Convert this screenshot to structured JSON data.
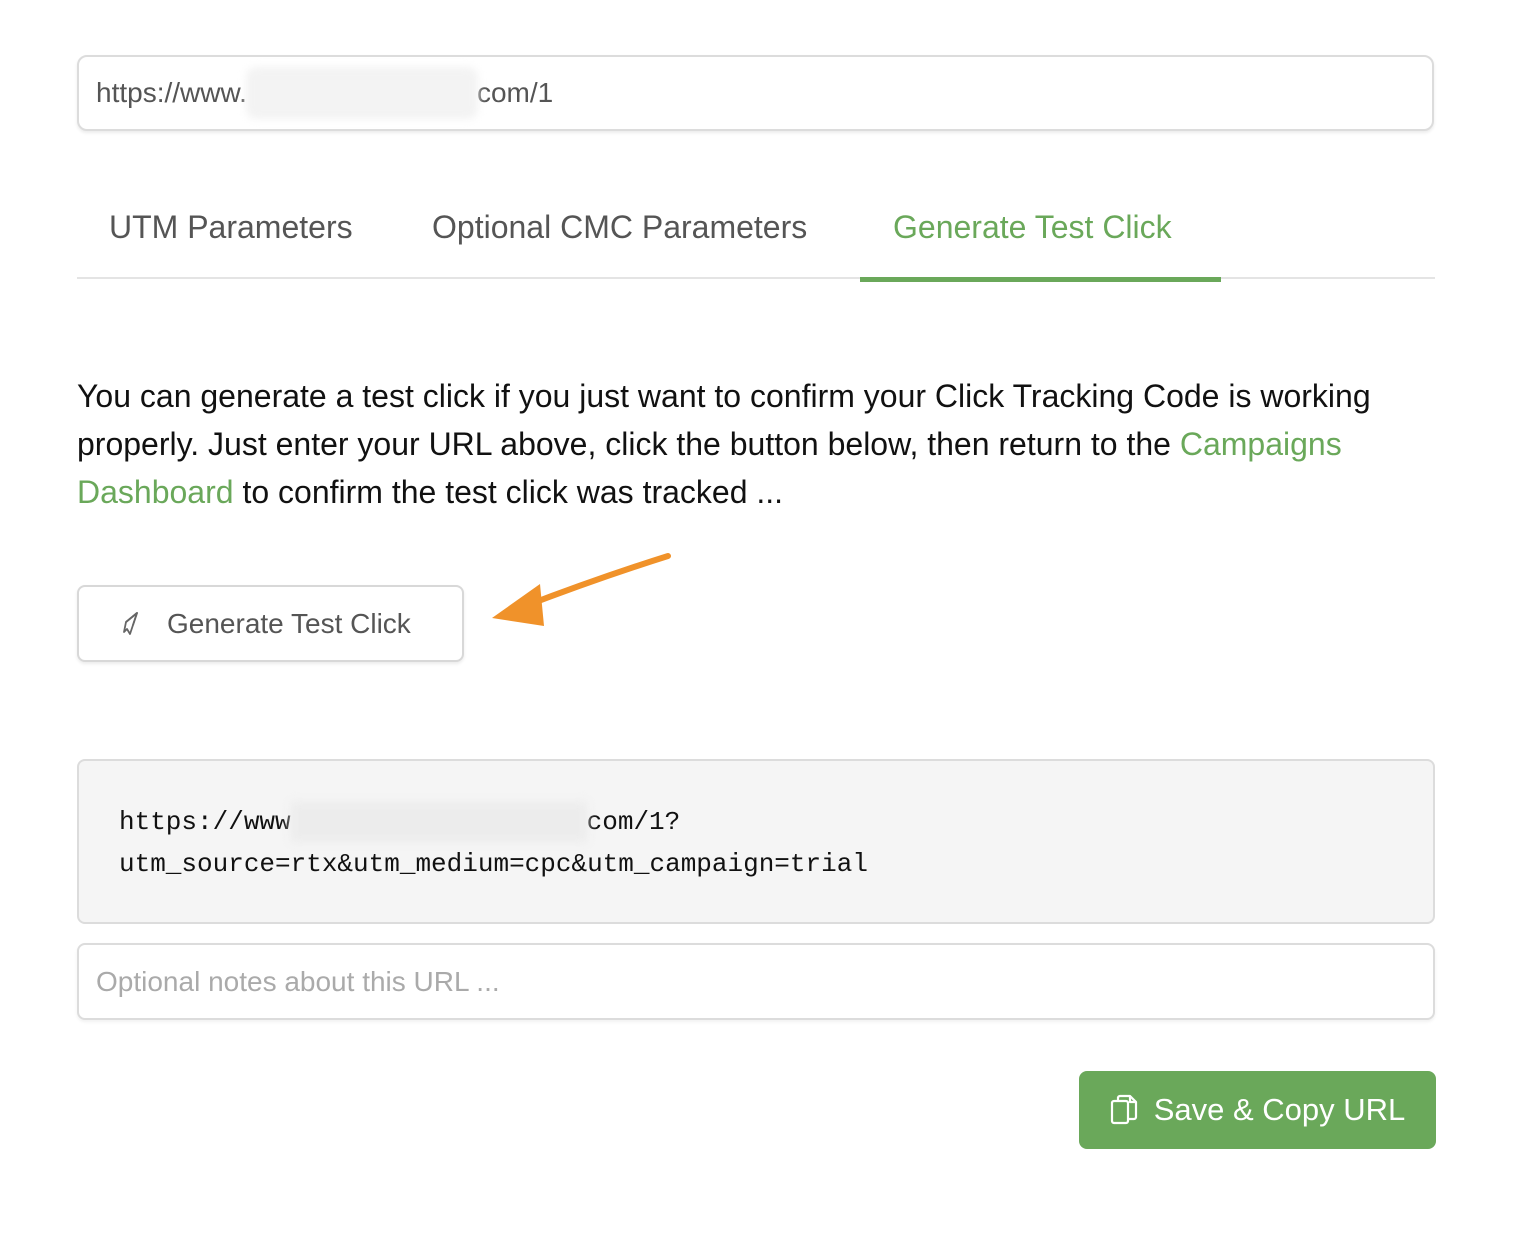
{
  "url_input": {
    "prefix": "https://www.",
    "suffix": "com/1"
  },
  "tabs": [
    {
      "label": "UTM Parameters",
      "active": false
    },
    {
      "label": "Optional CMC Parameters",
      "active": false
    },
    {
      "label": "Generate Test Click",
      "active": true
    }
  ],
  "description": {
    "text_before": "You can generate a test click if you just want to confirm your Click Tracking Code is working properly. Just enter your URL above, click the button below, then return to the ",
    "link_text": "Campaigns Dashboard",
    "text_after": " to confirm the test click was tracked ..."
  },
  "test_button": {
    "label": "Generate Test Click",
    "icon": "rocket-icon"
  },
  "generated_url": {
    "line1_prefix": "https://www",
    "line1_suffix": "com/1?",
    "line2": "utm_source=rtx&utm_medium=cpc&utm_campaign=trial"
  },
  "notes": {
    "placeholder": "Optional notes about this URL ..."
  },
  "save_button": {
    "label": "Save & Copy URL",
    "icon": "copy-icon"
  },
  "colors": {
    "accent": "#6aa85a",
    "annotation_arrow": "#f0922a"
  }
}
